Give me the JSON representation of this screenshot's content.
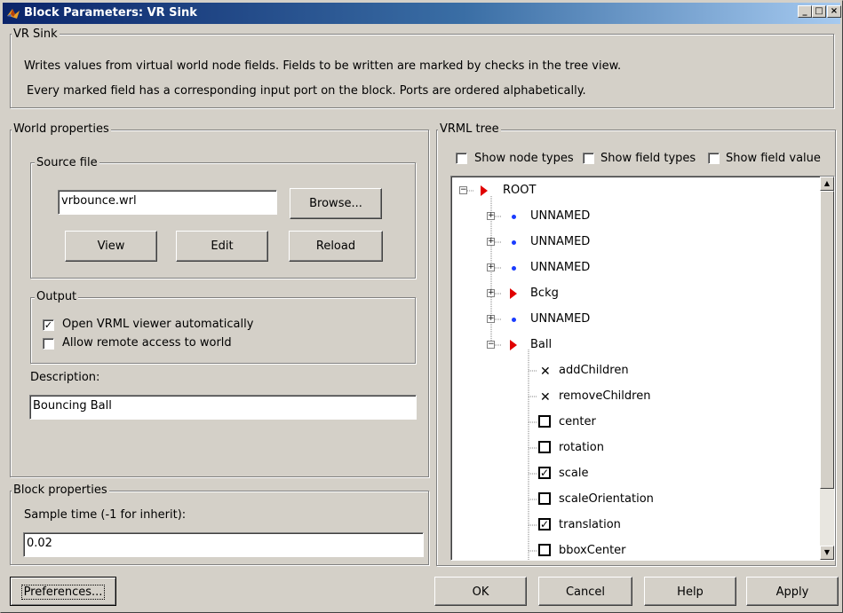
{
  "window": {
    "title": "Block Parameters: VR Sink",
    "min_glyph": "_",
    "max_glyph": "□",
    "close_glyph": "×"
  },
  "header": {
    "group_label": "VR Sink",
    "line1": "Writes values from virtual world node fields. Fields to be written are marked by checks in the tree view.",
    "line2": "Every marked field has a corresponding input port on the block. Ports are ordered alphabetically."
  },
  "world_properties": {
    "group_label": "World properties",
    "source_file": {
      "group_label": "Source file",
      "value": "vrbounce.wrl",
      "browse_label": "Browse...",
      "view_label": "View",
      "edit_label": "Edit",
      "reload_label": "Reload"
    },
    "output": {
      "group_label": "Output",
      "open_viewer_label": "Open VRML viewer automatically",
      "open_viewer_checked": true,
      "remote_access_label": "Allow remote access to world",
      "remote_access_checked": false
    },
    "description_label": "Description:",
    "description_value": "Bouncing Ball"
  },
  "block_properties": {
    "group_label": "Block properties",
    "sample_time_label": "Sample time (-1 for inherit):",
    "sample_time_value": "0.02"
  },
  "vrml_tree": {
    "group_label": "VRML tree",
    "show_node_types_label": "Show node types",
    "show_field_types_label": "Show field types",
    "show_field_value_label": "Show field value",
    "root_label": "ROOT",
    "nodes": [
      {
        "label": "UNNAMED",
        "kind": "dot",
        "expander": "+"
      },
      {
        "label": "UNNAMED",
        "kind": "dot",
        "expander": "+"
      },
      {
        "label": "UNNAMED",
        "kind": "dot",
        "expander": "+"
      },
      {
        "label": "Bckg",
        "kind": "arrow",
        "expander": "+"
      },
      {
        "label": "UNNAMED",
        "kind": "dot",
        "expander": "+"
      },
      {
        "label": "Ball",
        "kind": "arrow",
        "expander": "−"
      }
    ],
    "fields": [
      {
        "label": "addChildren",
        "kind": "x",
        "checked": false
      },
      {
        "label": "removeChildren",
        "kind": "x",
        "checked": false
      },
      {
        "label": "center",
        "kind": "cb",
        "checked": false
      },
      {
        "label": "rotation",
        "kind": "cb",
        "checked": false
      },
      {
        "label": "scale",
        "kind": "cb",
        "checked": true
      },
      {
        "label": "scaleOrientation",
        "kind": "cb",
        "checked": false
      },
      {
        "label": "translation",
        "kind": "cb",
        "checked": true
      },
      {
        "label": "bboxCenter",
        "kind": "cb",
        "checked": false
      }
    ]
  },
  "footer": {
    "preferences_label": "Preferences...",
    "ok_label": "OK",
    "cancel_label": "Cancel",
    "help_label": "Help",
    "apply_label": "Apply"
  },
  "glyphs": {
    "check": "✓",
    "x": "✕",
    "up": "▲",
    "down": "▼"
  },
  "colors": {
    "title_gradient_start": "#0a246a",
    "title_gradient_end": "#a6caf0",
    "node_arrow": "#e00000",
    "node_dot": "#1a3cff",
    "face": "#d4d0c8"
  }
}
